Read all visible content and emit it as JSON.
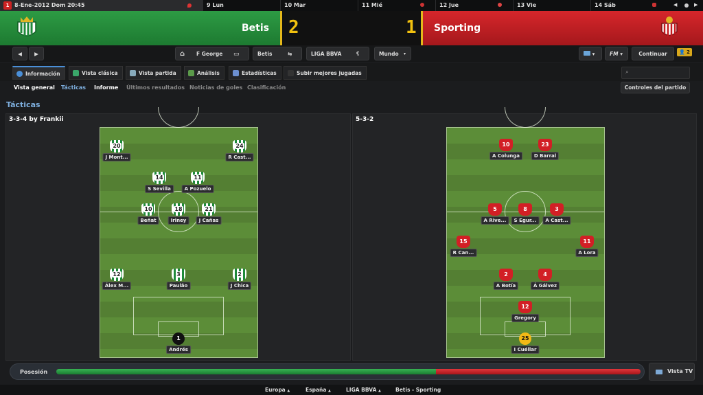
{
  "datebar": {
    "current": "8-Ene-2012 Dom 20:45",
    "days": [
      "9 Lun",
      "10 Mar",
      "11 Mié",
      "12 Jue",
      "13 Vie",
      "14 Sáb"
    ]
  },
  "match": {
    "home_team": "Betis",
    "away_team": "Sporting",
    "home_score": "2",
    "away_score": "1",
    "home_color": "#2d9b44",
    "away_color": "#d6262b"
  },
  "toolbar": {
    "manager": "F George",
    "club": "Betis",
    "league": "LIGA BBVA",
    "world": "Mundo",
    "fm": "FM",
    "continue": "Continuar",
    "badge": "2"
  },
  "tabs": [
    "Información",
    "Vista clásica",
    "Vista partida",
    "Análisis",
    "Estadísticas",
    "Subir mejores jugadas"
  ],
  "subnav": [
    "Vista general",
    "Tácticas",
    "Informe",
    "Últimos resultados",
    "Noticias de goles",
    "Clasificación"
  ],
  "match_controls": "Controles del partido",
  "page_title": "Tácticas",
  "home_panel": {
    "formation": "3-3-4 by Frankii",
    "players": [
      {
        "num": "20",
        "name": "J Mont..."
      },
      {
        "num": "24",
        "name": "R Cast..."
      },
      {
        "num": "14",
        "name": "S Sevilla"
      },
      {
        "num": "11",
        "name": "A Pozuelo"
      },
      {
        "num": "10",
        "name": "Beñat"
      },
      {
        "num": "18",
        "name": "Iriney"
      },
      {
        "num": "21",
        "name": "J Cañas"
      },
      {
        "num": "12",
        "name": "Álex M..."
      },
      {
        "num": "3",
        "name": "Paulão"
      },
      {
        "num": "2",
        "name": "J Chica"
      },
      {
        "num": "1",
        "name": "Andrés"
      }
    ]
  },
  "away_panel": {
    "formation": "5-3-2",
    "players": [
      {
        "num": "10",
        "name": "A Colunga"
      },
      {
        "num": "23",
        "name": "D Barral"
      },
      {
        "num": "5",
        "name": "A Rive..."
      },
      {
        "num": "8",
        "name": "S Egur..."
      },
      {
        "num": "3",
        "name": "A Cast..."
      },
      {
        "num": "15",
        "name": "R Can..."
      },
      {
        "num": "11",
        "name": "A Lora"
      },
      {
        "num": "2",
        "name": "A Botía"
      },
      {
        "num": "4",
        "name": "Á Gálvez"
      },
      {
        "num": "12",
        "name": "Gregory"
      },
      {
        "num": "25",
        "name": "I Cuéllar"
      }
    ]
  },
  "possession": {
    "label": "Posesión",
    "home_fraction": 0.65
  },
  "vista_tv": "Vista TV",
  "footer": [
    "Europa",
    "España",
    "LIGA BBVA",
    "Betis - Sporting"
  ]
}
